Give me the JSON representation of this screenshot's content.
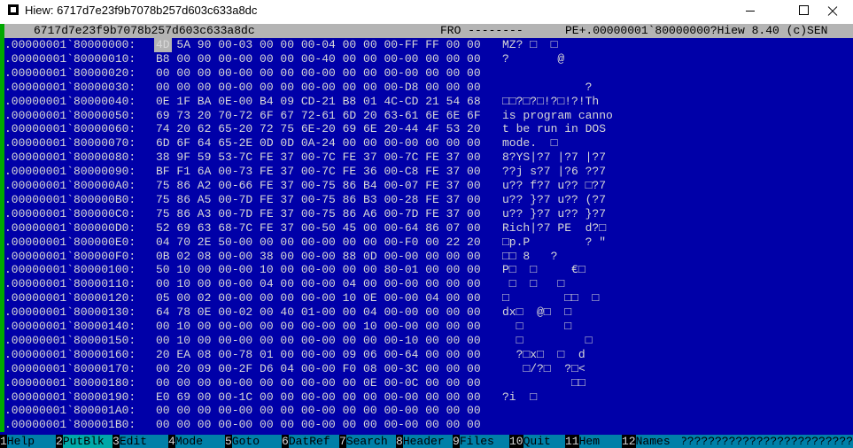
{
  "window": {
    "title": "Hiew: 6717d7e23f9b7078b257d603c633a8dc"
  },
  "infobar": {
    "filename": "6717d7e23f9b7078b257d603c633a8dc",
    "mode": "FRO --------",
    "info": "PE+.00000001`80000000?Hiew 8.40 (c)SEN"
  },
  "rows": [
    {
      "addr": ".00000001`80000000:",
      "hex": "4D 5A 90 00-03 00 00 00-04 00 00 00-FF FF 00 00",
      "ascii": "MZ? □  □"
    },
    {
      "addr": "?.00000001`80000010:",
      "hex": "B8 00 00 00-00 00 00 00-40 00 00 00-00 00 00 00",
      "ascii": "?       @"
    },
    {
      "addr": "?.00000001`80000020:",
      "hex": "00 00 00 00-00 00 00 00-00 00 00 00-00 00 00 00",
      "ascii": ""
    },
    {
      "addr": "?.00000001`80000030:",
      "hex": "00 00 00 00-00 00 00 00-00 00 00 00-D8 00 00 00",
      "ascii": "            ?"
    },
    {
      "addr": "?.00000001`80000040:",
      "hex": "0E 1F BA 0E-00 B4 09 CD-21 B8 01 4C-CD 21 54 68",
      "ascii": "□□?□?□!?□!?!Th"
    },
    {
      "addr": "?.00000001`80000050:",
      "hex": "69 73 20 70-72 6F 67 72-61 6D 20 63-61 6E 6E 6F",
      "ascii": "is program canno"
    },
    {
      "addr": "?.00000001`80000060:",
      "hex": "74 20 62 65-20 72 75 6E-20 69 6E 20-44 4F 53 20",
      "ascii": "t be run in DOS"
    },
    {
      "addr": "?.00000001`80000070:",
      "hex": "6D 6F 64 65-2E 0D 0D 0A-24 00 00 00-00 00 00 00",
      "ascii": "mode.  □"
    },
    {
      "addr": "?.00000001`80000080:",
      "hex": "38 9F 59 53-7C FE 37 00-7C FE 37 00-7C FE 37 00",
      "ascii": "8?YS|?7 |?7 |?7"
    },
    {
      "addr": "?.00000001`80000090:",
      "hex": "BF F1 6A 00-73 FE 37 00-7C FE 36 00-C8 FE 37 00",
      "ascii": "??j s?7 |?6 ??7"
    },
    {
      "addr": "?.00000001`800000A0:",
      "hex": "75 86 A2 00-66 FE 37 00-75 86 B4 00-07 FE 37 00",
      "ascii": "u?? f?7 u?? □?7"
    },
    {
      "addr": "?.00000001`800000B0:",
      "hex": "75 86 A5 00-7D FE 37 00-75 86 B3 00-28 FE 37 00",
      "ascii": "u?? }?7 u?? (?7"
    },
    {
      "addr": "?.00000001`800000C0:",
      "hex": "75 86 A3 00-7D FE 37 00-75 86 A6 00-7D FE 37 00",
      "ascii": "u?? }?7 u?? }?7"
    },
    {
      "addr": "?.00000001`800000D0:",
      "hex": "52 69 63 68-7C FE 37 00-50 45 00 00-64 86 07 00",
      "ascii": "Rich|?7 PE  d?□"
    },
    {
      "addr": "?.00000001`800000E0:",
      "hex": "04 70 2E 50-00 00 00 00-00 00 00 00-F0 00 22 20",
      "ascii": "□p.P        ? ″"
    },
    {
      "addr": "?.00000001`800000F0:",
      "hex": "0B 02 08 00-00 38 00 00-00 88 0D 00-00 00 00 00",
      "ascii": "□□ 8   ?"
    },
    {
      "addr": "?.00000001`80000100:",
      "hex": "50 10 00 00-00 10 00 00-00 00 00 80-01 00 00 00",
      "ascii": "P□  □     €□"
    },
    {
      "addr": "?.00000001`80000110:",
      "hex": "00 10 00 00-00 04 00 00-00 04 00 00-00 00 00 00",
      "ascii": " □  □   □"
    },
    {
      "addr": "?.00000001`80000120:",
      "hex": "05 00 02 00-00 00 00 00-00 10 0E 00-00 04 00 00",
      "ascii": "□        □□  □"
    },
    {
      "addr": "?.00000001`80000130:",
      "hex": "64 78 0E 00-02 00 40 01-00 00 04 00-00 00 00 00",
      "ascii": "dx□  @□  □"
    },
    {
      "addr": "?.00000001`80000140:",
      "hex": "00 10 00 00-00 00 00 00-00 00 10 00-00 00 00 00",
      "ascii": "  □      □"
    },
    {
      "addr": "?.00000001`80000150:",
      "hex": "00 10 00 00-00 00 00 00-00 00 00 00-10 00 00 00",
      "ascii": "  □         □"
    },
    {
      "addr": "?.00000001`80000160:",
      "hex": "20 EA 08 00-78 01 00 00-00 09 06 00-64 00 00 00",
      "ascii": "  ?□x□  □  d"
    },
    {
      "addr": "?.00000001`80000170:",
      "hex": "00 20 09 00-2F D6 04 00-00 F0 08 00-3C 00 00 00",
      "ascii": "   □/?□  ?□<"
    },
    {
      "addr": "?.00000001`80000180:",
      "hex": "00 00 00 00-00 00 00 00-00 00 0E 00-0C 00 00 00",
      "ascii": "          □□"
    },
    {
      "addr": "?.00000001`80000190:",
      "hex": "E0 69 00 00-1C 00 00 00-00 00 00 00-00 00 00 00",
      "ascii": "?i  □"
    },
    {
      "addr": "?.00000001`800001A0:",
      "hex": "00 00 00 00-00 00 00 00-00 00 00 00-00 00 00 00",
      "ascii": ""
    },
    {
      "addr": "?.00000001`800001B0:",
      "hex": "00 00 00 00-00 00 00 00-00 00 00 00-00 00 00 00",
      "ascii": ""
    }
  ],
  "fkeys": [
    {
      "num": "1",
      "label": "Help"
    },
    {
      "num": "2",
      "label": "PutBlk"
    },
    {
      "num": "3",
      "label": "Edit"
    },
    {
      "num": "4",
      "label": "Mode"
    },
    {
      "num": "5",
      "label": "Goto"
    },
    {
      "num": "6",
      "label": "DatRef"
    },
    {
      "num": "7",
      "label": "Search"
    },
    {
      "num": "8",
      "label": "Header"
    },
    {
      "num": "9",
      "label": "Files"
    },
    {
      "num": "10",
      "label": "Quit"
    },
    {
      "num": "11",
      "label": "Hem"
    },
    {
      "num": "12",
      "label": "Names"
    }
  ],
  "fkeys_tail": "?????????????????????????",
  "colors": {
    "background": "#0000a8",
    "infobar": "#b4b4b4",
    "text": "#d8d8d8",
    "fkey_label": "#0080a8"
  }
}
